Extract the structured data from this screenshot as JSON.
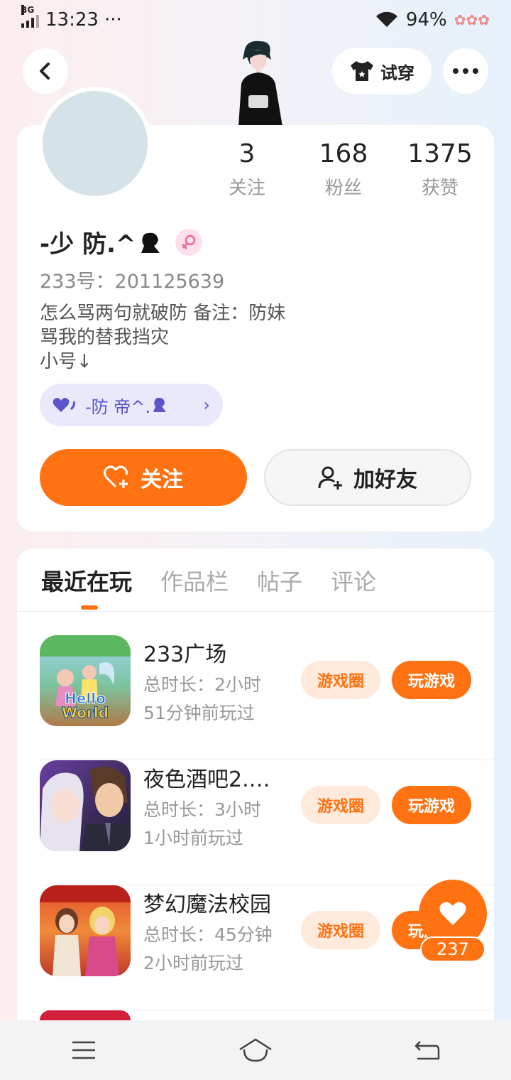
{
  "status_bar": {
    "network": "3G",
    "time": "13:23",
    "dots": "···",
    "battery": "94%"
  },
  "header": {
    "try_on_label": "试穿"
  },
  "profile": {
    "stats": [
      {
        "value": "3",
        "label": "关注"
      },
      {
        "value": "168",
        "label": "粉丝"
      },
      {
        "value": "1375",
        "label": "获赞"
      }
    ],
    "username": "-少 防.^",
    "uid_label": "233号：201125639",
    "bio_lines": [
      "怎么骂两句就破防 备注：防妹",
      "骂我的替我挡灾",
      "小号↓"
    ],
    "linked_account": "-防  帝^.",
    "follow_label": "关注",
    "add_friend_label": "加好友"
  },
  "tabs": [
    {
      "label": "最近在玩",
      "active": true
    },
    {
      "label": "作品栏",
      "active": false
    },
    {
      "label": "帖子",
      "active": false
    },
    {
      "label": "评论",
      "active": false
    }
  ],
  "games": [
    {
      "name": "233广场",
      "total_time": "总时长：2小时",
      "last_played": "51分钟前玩过",
      "circle_label": "游戏圈",
      "play_label": "玩游戏",
      "icon_text": "Hello World"
    },
    {
      "name": "夜色酒吧2.…",
      "total_time": "总时长：3小时",
      "last_played": "1小时前玩过",
      "circle_label": "游戏圈",
      "play_label": "玩游戏",
      "icon_text": ""
    },
    {
      "name": "梦幻魔法校园",
      "total_time": "总时长：45分钟",
      "last_played": "2小时前玩过",
      "circle_label": "游戏圈",
      "play_label": "玩游戏",
      "icon_text": ""
    }
  ],
  "like_fab": {
    "count": "237"
  },
  "colors": {
    "accent": "#ff7212",
    "pill_purple": "#5b55c9"
  }
}
